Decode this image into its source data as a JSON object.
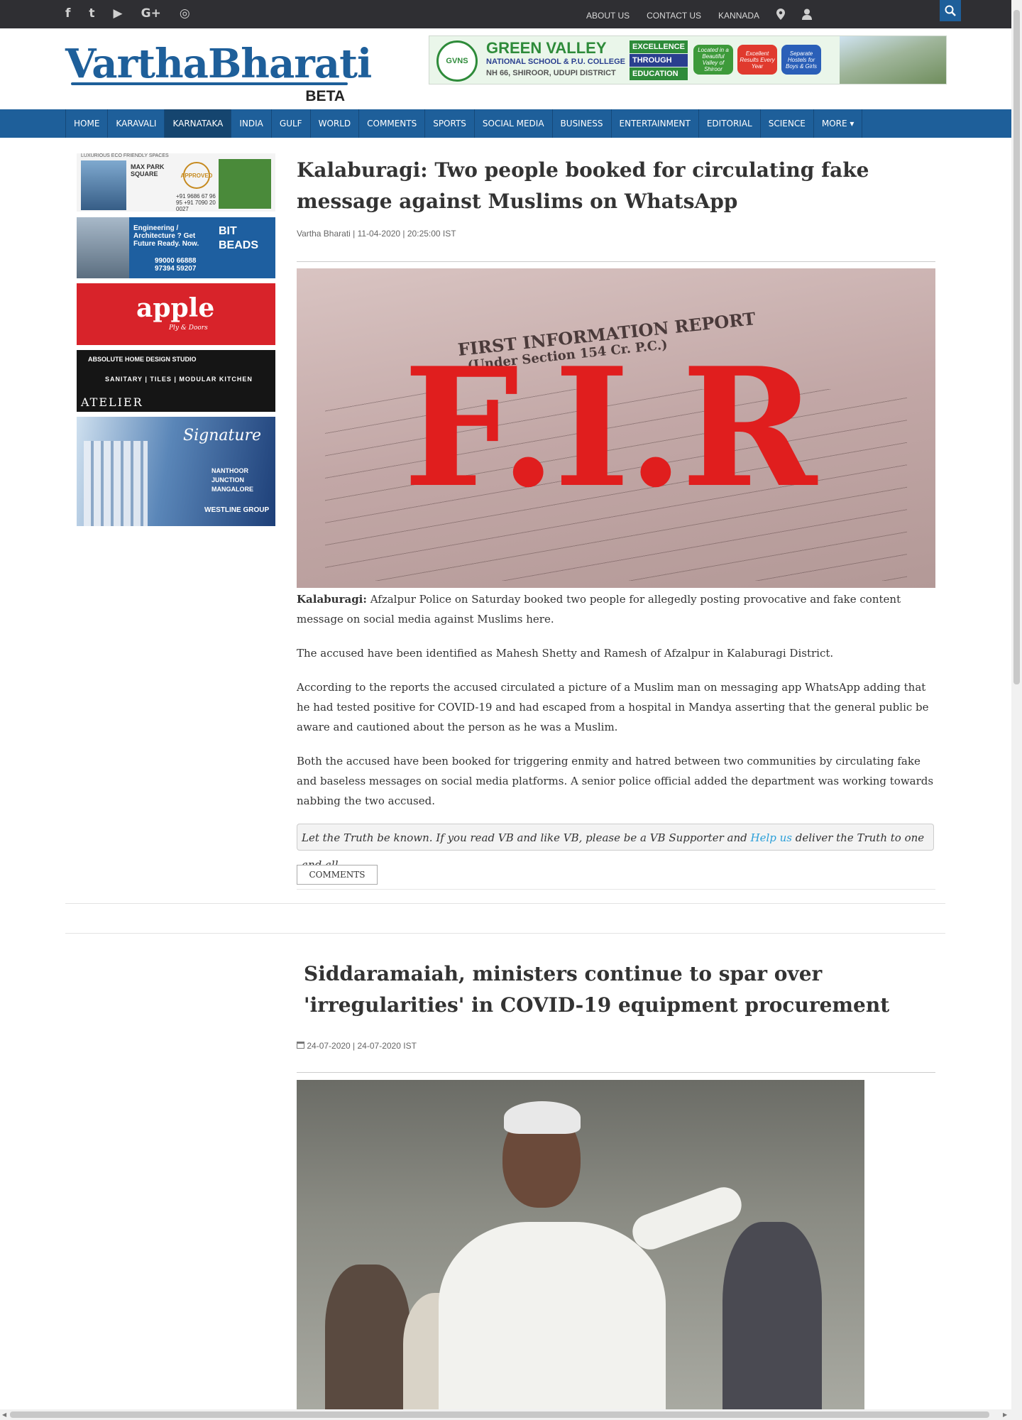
{
  "topbar": {
    "social_icons": [
      "facebook-icon",
      "twitter-icon",
      "youtube-icon",
      "google-plus-icon",
      "instagram-icon"
    ],
    "social_glyphs": [
      "f",
      "t",
      "▶",
      "G+",
      "◎"
    ],
    "links": [
      "ABOUT US",
      "CONTACT US",
      "KANNADA"
    ],
    "location_icon": "map-marker-icon",
    "user_icon": "user-icon",
    "search_icon": "search-icon"
  },
  "header": {
    "logo_vartha": "Vartha",
    "logo_bharati": "Bharati",
    "logo_beta": "BETA",
    "ad": {
      "seal": "GVNS",
      "name": "GREEN VALLEY",
      "line2": "NATIONAL SCHOOL & P.U. COLLEGE",
      "line3": "NH 66, SHIROOR, UDUPI DISTRICT",
      "excellence": [
        "EXCELLENCE",
        "THROUGH",
        "EDUCATION"
      ],
      "pills": [
        "Located in a Beautiful Valley of Shiroor",
        "Excellent Results Every Year",
        "Separate Hostels for Boys & Girls"
      ]
    }
  },
  "nav": {
    "items": [
      "HOME",
      "KARAVALI",
      "KARNATAKA",
      "INDIA",
      "GULF",
      "WORLD",
      "COMMENTS",
      "SPORTS",
      "SOCIAL MEDIA",
      "BUSINESS",
      "ENTERTAINMENT",
      "EDITORIAL",
      "SCIENCE",
      "MORE ▾"
    ],
    "active": "KARNATAKA"
  },
  "side_ads": {
    "ad1": {
      "tag": "LUXURIOUS ECO FRIENDLY SPACES",
      "name": "MAX PARK SQUARE",
      "approved": "APPROVED",
      "phone": "+91 9686 67 96 95 +91 7090 20 0027"
    },
    "ad2": {
      "text": "Engineering / Architecture ? Get Future Ready. Now.",
      "brand": "BIT BEADS",
      "phone": "99000 66888 97394 59207"
    },
    "ad3": {
      "brand": "apple",
      "sub": "Ply & Doors"
    },
    "ad4": {
      "a": "ABSOLUTE HOME DESIGN STUDIO",
      "b": "SANITARY | TILES | MODULAR KITCHEN",
      "c": "ATELIER"
    },
    "ad5": {
      "sig": "Signature",
      "loc": "NANTHOOR JUNCTION MANGALORE",
      "group": "WESTLINE GROUP"
    }
  },
  "article1": {
    "title": "Kalaburagi: Two people booked for circulating fake message against Muslims on WhatsApp",
    "meta": "Vartha Bharati | 11-04-2020 | 20:25:00 IST",
    "image_label": "F.I.R",
    "image_text": [
      "FIRST INFORMATION REPORT",
      "(Under Section 154 Cr. P.C.)"
    ],
    "lead_place": "Kalaburagi:",
    "lead_text": "Afzalpur Police on Saturday booked two people for allegedly posting provocative and fake content message on social media against Muslims here.",
    "p2": "The accused have been identified as Mahesh Shetty and Ramesh of Afzalpur in Kalaburagi District.",
    "p3": "According to the reports the accused circulated a picture of a Muslim man on messaging app WhatsApp adding that he had tested positive for COVID-19 and had escaped from a hospital in Mandya asserting that the general public be aware and cautioned about the person as he was a Muslim.",
    "p4": "Both the accused have been booked for triggering enmity and hatred between two communities by circulating fake and baseless messages on social media platforms. A senior police official added the department was working towards nabbing the two accused.",
    "support_pre": "Let the Truth be known. If you read VB and like VB, please be a VB Supporter and",
    "support_link": "Help us",
    "support_post": "deliver the Truth to one and all.",
    "comments_button": "COMMENTS"
  },
  "article2": {
    "title": "Siddaramaiah, ministers continue to spar over 'irregularities' in COVID-19 equipment procurement",
    "meta": "24-07-2020 | 24-07-2020 IST",
    "calendar_icon": "calendar-icon"
  }
}
